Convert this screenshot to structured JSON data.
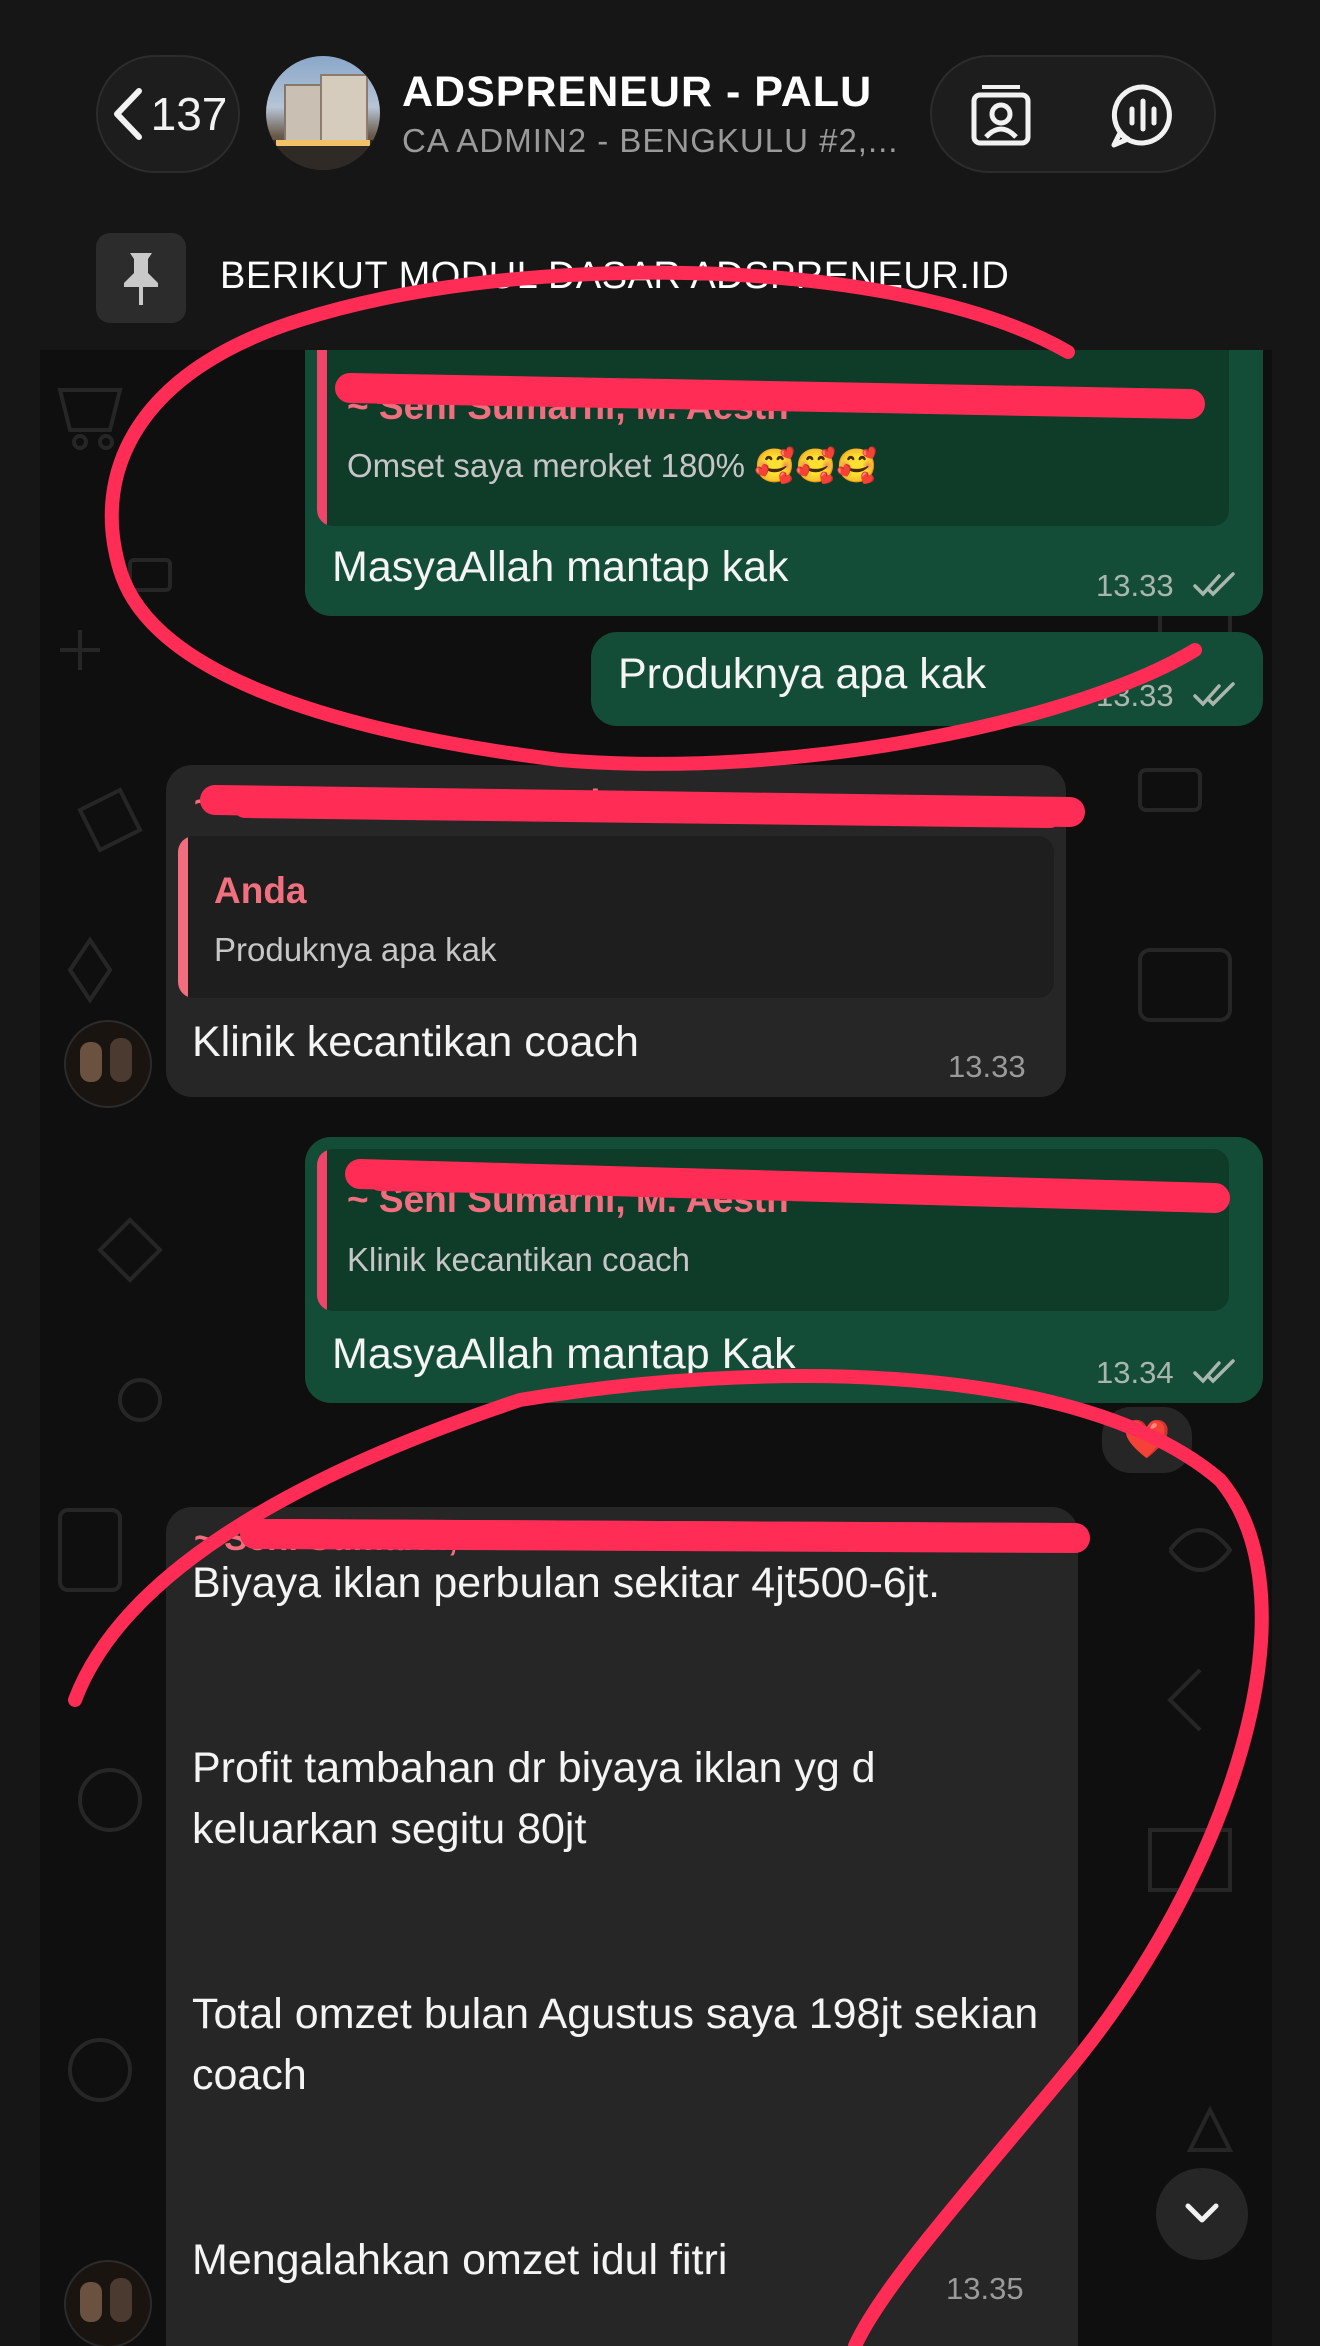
{
  "header": {
    "back_count": "137",
    "group_name": "ADSPRENEUR - PALU",
    "members_preview": "CA ADMIN2 - BENGKULU #2,..."
  },
  "pinned": {
    "text": "BERIKUT MODUL DASAR ADSPRENEUR.ID"
  },
  "messages": [
    {
      "id": "m1",
      "direction": "outgoing",
      "quote_author": "~ Seni Sumarni, M. Aesth",
      "quote_text": "Omset saya meroket 180% 🥰🥰🥰",
      "text": "MasyaAllah mantap kak",
      "time": "13.33"
    },
    {
      "id": "m2",
      "direction": "outgoing",
      "text": "Produknya apa kak",
      "time": "13.33"
    },
    {
      "id": "m3",
      "direction": "incoming",
      "sender": "~ Seni Sumarni, M. Aesth",
      "quote_author": "Anda",
      "quote_text": "Produknya apa kak",
      "text": "Klinik kecantikan coach",
      "time": "13.33"
    },
    {
      "id": "m4",
      "direction": "outgoing",
      "quote_author": "~ Seni Sumarni, M. Aesth",
      "quote_text": "Klinik kecantikan coach",
      "text": "MasyaAllah mantap Kak",
      "time": "13.34",
      "reaction": "❤️"
    },
    {
      "id": "m5",
      "direction": "incoming",
      "sender": "~ Seni Sumarni, M. Aesth",
      "paragraphs": [
        "Biyaya iklan perbulan sekitar 4jt500-6jt.",
        "Profit tambahan dr biyaya iklan yg d keluarkan segitu 80jt",
        "Total omzet bulan Agustus saya 198jt sekian coach",
        "Mengalahkan omzet idul fitri"
      ],
      "time": "13.35"
    }
  ],
  "colors": {
    "outgoing_bubble": "#144d37",
    "incoming_bubble": "#262626",
    "quote_bar_out": "#f0446a",
    "quote_bar_in": "#f06e7e",
    "annotation_red": "#ff2d55"
  },
  "icons": [
    "chevron-left-icon",
    "contact-card-icon",
    "voice-chat-icon",
    "pin-icon",
    "double-check-icon",
    "chevron-down-icon"
  ]
}
